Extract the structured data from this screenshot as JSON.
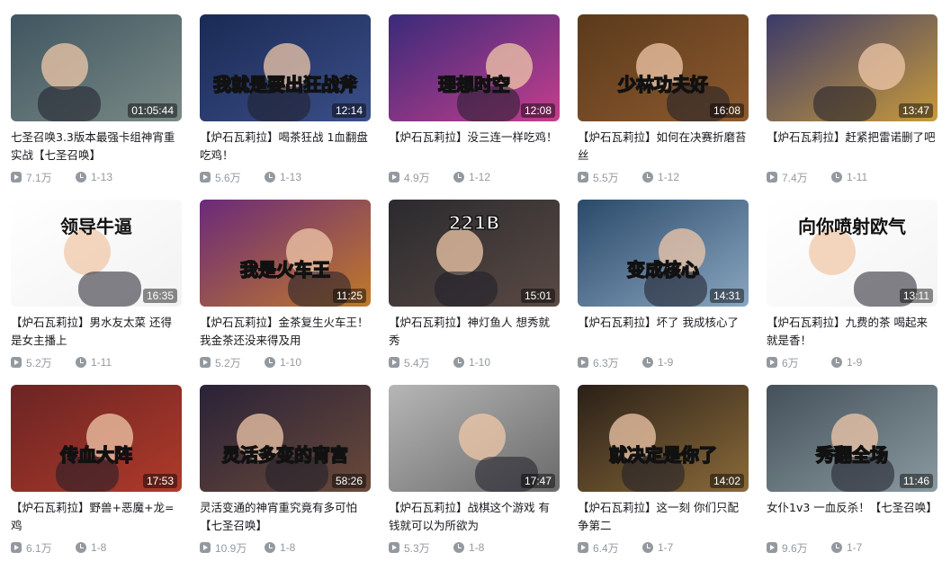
{
  "videos": [
    {
      "title": "七圣召唤3.3版本最强卡组神宵重实战【七圣召唤】",
      "views": "7.1万",
      "date": "1-13",
      "duration": "01:05:44",
      "thumb_text": "",
      "colors": [
        "#3f5560",
        "#7a8a86"
      ]
    },
    {
      "title": "【炉石瓦莉拉】喝茶狂战 1血翻盘吃鸡！",
      "views": "5.6万",
      "date": "1-13",
      "duration": "12:14",
      "thumb_text": "我就是要出狂战斧",
      "colors": [
        "#1a2a55",
        "#3b4f88"
      ]
    },
    {
      "title": "【炉石瓦莉拉】没三连一样吃鸡！",
      "views": "4.9万",
      "date": "1-12",
      "duration": "12:08",
      "thumb_text": "理想时空",
      "colors": [
        "#3a2a7a",
        "#c53e8d"
      ]
    },
    {
      "title": "【炉石瓦莉拉】如何在决赛折磨苔丝",
      "views": "5.5万",
      "date": "1-12",
      "duration": "16:08",
      "thumb_text": "少林功夫好",
      "colors": [
        "#5a3a1c",
        "#8d5a2e"
      ]
    },
    {
      "title": "【炉石瓦莉拉】赶紧把雷诺删了吧",
      "views": "7.4万",
      "date": "1-11",
      "duration": "13:47",
      "thumb_text": "",
      "colors": [
        "#3a3a6a",
        "#c89a3c"
      ]
    },
    {
      "title": "【炉石瓦莉拉】男水友太菜 还得是女主播上",
      "views": "5.2万",
      "date": "1-11",
      "duration": "16:35",
      "thumb_text": "领导牛逼",
      "colors": [
        "#ffffff",
        "#f2f2f2"
      ]
    },
    {
      "title": "【炉石瓦莉拉】金茶复生火车王！我金茶还没来得及用",
      "views": "5.2万",
      "date": "1-10",
      "duration": "11:25",
      "thumb_text": "我是火车王",
      "colors": [
        "#6a2a7a",
        "#c07a2a"
      ]
    },
    {
      "title": "【炉石瓦莉拉】神灯鱼人 想秀就秀",
      "views": "5.4万",
      "date": "1-10",
      "duration": "15:01",
      "thumb_text": "221B",
      "colors": [
        "#2a2a2e",
        "#5a4a44"
      ]
    },
    {
      "title": "【炉石瓦莉拉】坏了 我成核心了",
      "views": "6.3万",
      "date": "1-9",
      "duration": "14:31",
      "thumb_text": "变成核心",
      "colors": [
        "#2a4a6a",
        "#8aa6c0"
      ]
    },
    {
      "title": "【炉石瓦莉拉】九费的茶 喝起来就是香！",
      "views": "6万",
      "date": "1-9",
      "duration": "13:11",
      "thumb_text": "向你喷射欧气",
      "colors": [
        "#ffffff",
        "#f4f4f4"
      ]
    },
    {
      "title": "【炉石瓦莉拉】野兽+恶魔+龙=鸡",
      "views": "6.1万",
      "date": "1-8",
      "duration": "17:53",
      "thumb_text": "传血大阵",
      "colors": [
        "#6a2424",
        "#b03a2a"
      ]
    },
    {
      "title": "灵活变通的神宵重究竟有多可怕【七圣召唤】",
      "views": "10.9万",
      "date": "1-8",
      "duration": "58:26",
      "thumb_text": "灵活多变的宵宫",
      "colors": [
        "#2a2238",
        "#6a4a3a"
      ]
    },
    {
      "title": "【炉石瓦莉拉】战棋这个游戏 有钱就可以为所欲为",
      "views": "5.3万",
      "date": "1-8",
      "duration": "17:47",
      "thumb_text": "",
      "colors": [
        "#b6b6b6",
        "#6a6a6a"
      ]
    },
    {
      "title": "【炉石瓦莉拉】这一刻 你们只配争第二",
      "views": "6.4万",
      "date": "1-7",
      "duration": "14:02",
      "thumb_text": "就决定是你了",
      "colors": [
        "#2a2018",
        "#8a6a3a"
      ]
    },
    {
      "title": "女仆1v3 一血反杀！【七圣召唤】",
      "views": "9.6万",
      "date": "1-7",
      "duration": "11:46",
      "thumb_text": "秀翻全场",
      "colors": [
        "#44505a",
        "#8a9aa0"
      ]
    }
  ]
}
